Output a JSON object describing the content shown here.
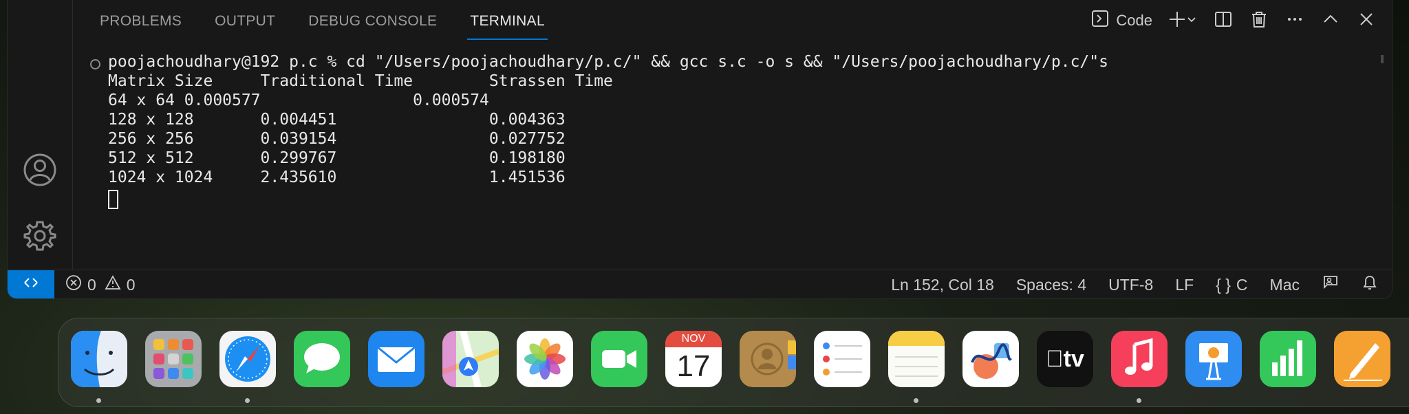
{
  "panel": {
    "tabs": [
      "PROBLEMS",
      "OUTPUT",
      "DEBUG CONSOLE",
      "TERMINAL"
    ],
    "active_tab": "TERMINAL",
    "terminal_profile": "Code"
  },
  "terminal": {
    "lines": [
      "poojachoudhary@192 p.c % cd \"/Users/poojachoudhary/p.c/\" && gcc s.c -o s && \"/Users/poojachoudhary/p.c/\"s",
      "Matrix Size     Traditional Time        Strassen Time",
      "64 x 64 0.000577                0.000574",
      "128 x 128       0.004451                0.004363",
      "256 x 256       0.039154                0.027752",
      "512 x 512       0.299767                0.198180",
      "1024 x 1024     2.435610                1.451536"
    ]
  },
  "status_bar": {
    "errors": "0",
    "warnings": "0",
    "position": "Ln 152, Col 18",
    "spaces": "Spaces: 4",
    "encoding": "UTF-8",
    "eol": "LF",
    "language": "C",
    "platform": "Mac"
  },
  "dock": {
    "calendar_month": "NOV",
    "calendar_day": "17",
    "apps": [
      "finder",
      "launchpad",
      "safari",
      "messages",
      "mail",
      "maps",
      "photos",
      "facetime",
      "calendar",
      "contacts",
      "reminders",
      "notes",
      "freeform",
      "tv",
      "music",
      "keynote",
      "numbers",
      "pages"
    ],
    "tv_label": "tv"
  },
  "colors": {
    "accent": "#0078d4",
    "background": "#181818",
    "text": "#cccccc"
  }
}
